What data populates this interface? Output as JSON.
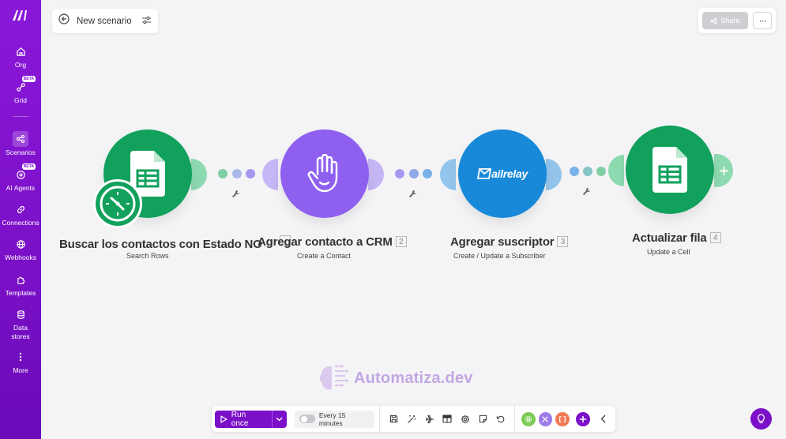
{
  "sidebar": {
    "items": [
      {
        "label": "Org",
        "icon": "home-icon"
      },
      {
        "label": "Grid",
        "icon": "grid-icon",
        "badge": "BETA"
      },
      {
        "label": "Scenarios",
        "icon": "share-icon",
        "active": true
      },
      {
        "label": "AI Agents",
        "icon": "ai-agent-icon",
        "badge": "BETA"
      },
      {
        "label": "Connections",
        "icon": "link-icon"
      },
      {
        "label": "Webhooks",
        "icon": "globe-icon"
      },
      {
        "label": "Templates",
        "icon": "puzzle-icon"
      },
      {
        "label": "Data stores",
        "icon": "database-icon"
      },
      {
        "label": "More",
        "icon": "more-vertical-icon"
      }
    ]
  },
  "header": {
    "title": "New scenario",
    "share_label": "Share",
    "more_label": "···"
  },
  "modules": [
    {
      "title": "Buscar los contactos con Estado NO",
      "subtitle": "Search Rows",
      "app": "google-sheets",
      "color": "#11a15c",
      "number": ""
    },
    {
      "title": "Agregar contacto a CRM",
      "subtitle": "Create a Contact",
      "app": "custom-hand",
      "color": "#8f60ef",
      "number": "2"
    },
    {
      "title": "Agregar suscriptor",
      "subtitle": "Create / Update a Subscriber",
      "app": "mailrelay",
      "color": "#1889d9",
      "number": "3",
      "logo_text": "ailrelay"
    },
    {
      "title": "Actualizar fila",
      "subtitle": "Update a Cell",
      "app": "google-sheets",
      "color": "#11a15c",
      "number": "4"
    }
  ],
  "watermark": {
    "text": "Automatiza.dev"
  },
  "toolbar": {
    "run_label": "Run once",
    "schedule_label": "Every 15 minutes"
  },
  "colors": {
    "brand": "#7b10c8",
    "sheets": "#11a15c",
    "crm": "#8f60ef",
    "mailrelay": "#1889d9"
  }
}
